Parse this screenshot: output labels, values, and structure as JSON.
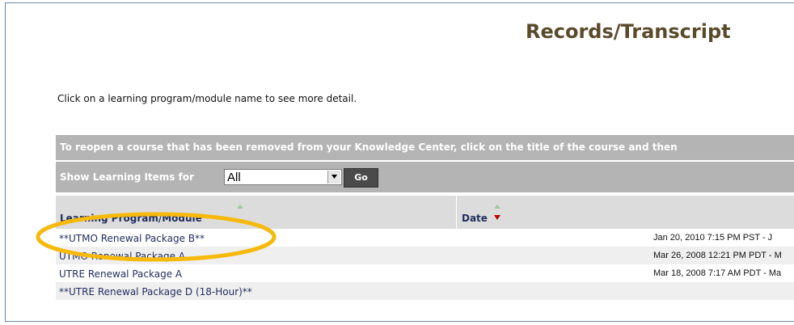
{
  "page": {
    "title": "Records/Transcript",
    "intro": "Click on a learning program/module name to see more detail."
  },
  "notice": {
    "text": "To reopen a course that has been removed from your Knowledge Center, click on the title of the course and then"
  },
  "filter": {
    "label": "Show Learning Items for",
    "selected": "All",
    "go_label": "Go"
  },
  "table": {
    "columns": {
      "program": "Learning Program/Module",
      "date": "Date"
    },
    "rows": [
      {
        "program": "**UTMO Renewal Package B**",
        "date": "Jan 20, 2010 7:15 PM PST - J"
      },
      {
        "program": "UTMO Renewal Package A",
        "date": "Mar 26, 2008 12:21 PM PDT - M"
      },
      {
        "program": "UTRE Renewal Package A",
        "date": "Mar 18, 2008 7:17 AM PDT - Ma"
      },
      {
        "program": "**UTRE Renewal Package D (18-Hour)**",
        "date": ""
      }
    ]
  },
  "colors": {
    "title": "#5a4a2b",
    "bar_gray": "#b4b4b4",
    "header_gray": "#dcdcdc",
    "row_alt": "#efefef",
    "link_navy": "#1f2d5c",
    "highlight_yellow": "#f6b90c",
    "sort_up_green": "#9fc7a0",
    "sort_down_red": "#c00000"
  },
  "icons": {
    "dropdown": "chevron-down-icon",
    "sort_up": "sort-up-icon",
    "sort_down": "sort-down-icon"
  }
}
